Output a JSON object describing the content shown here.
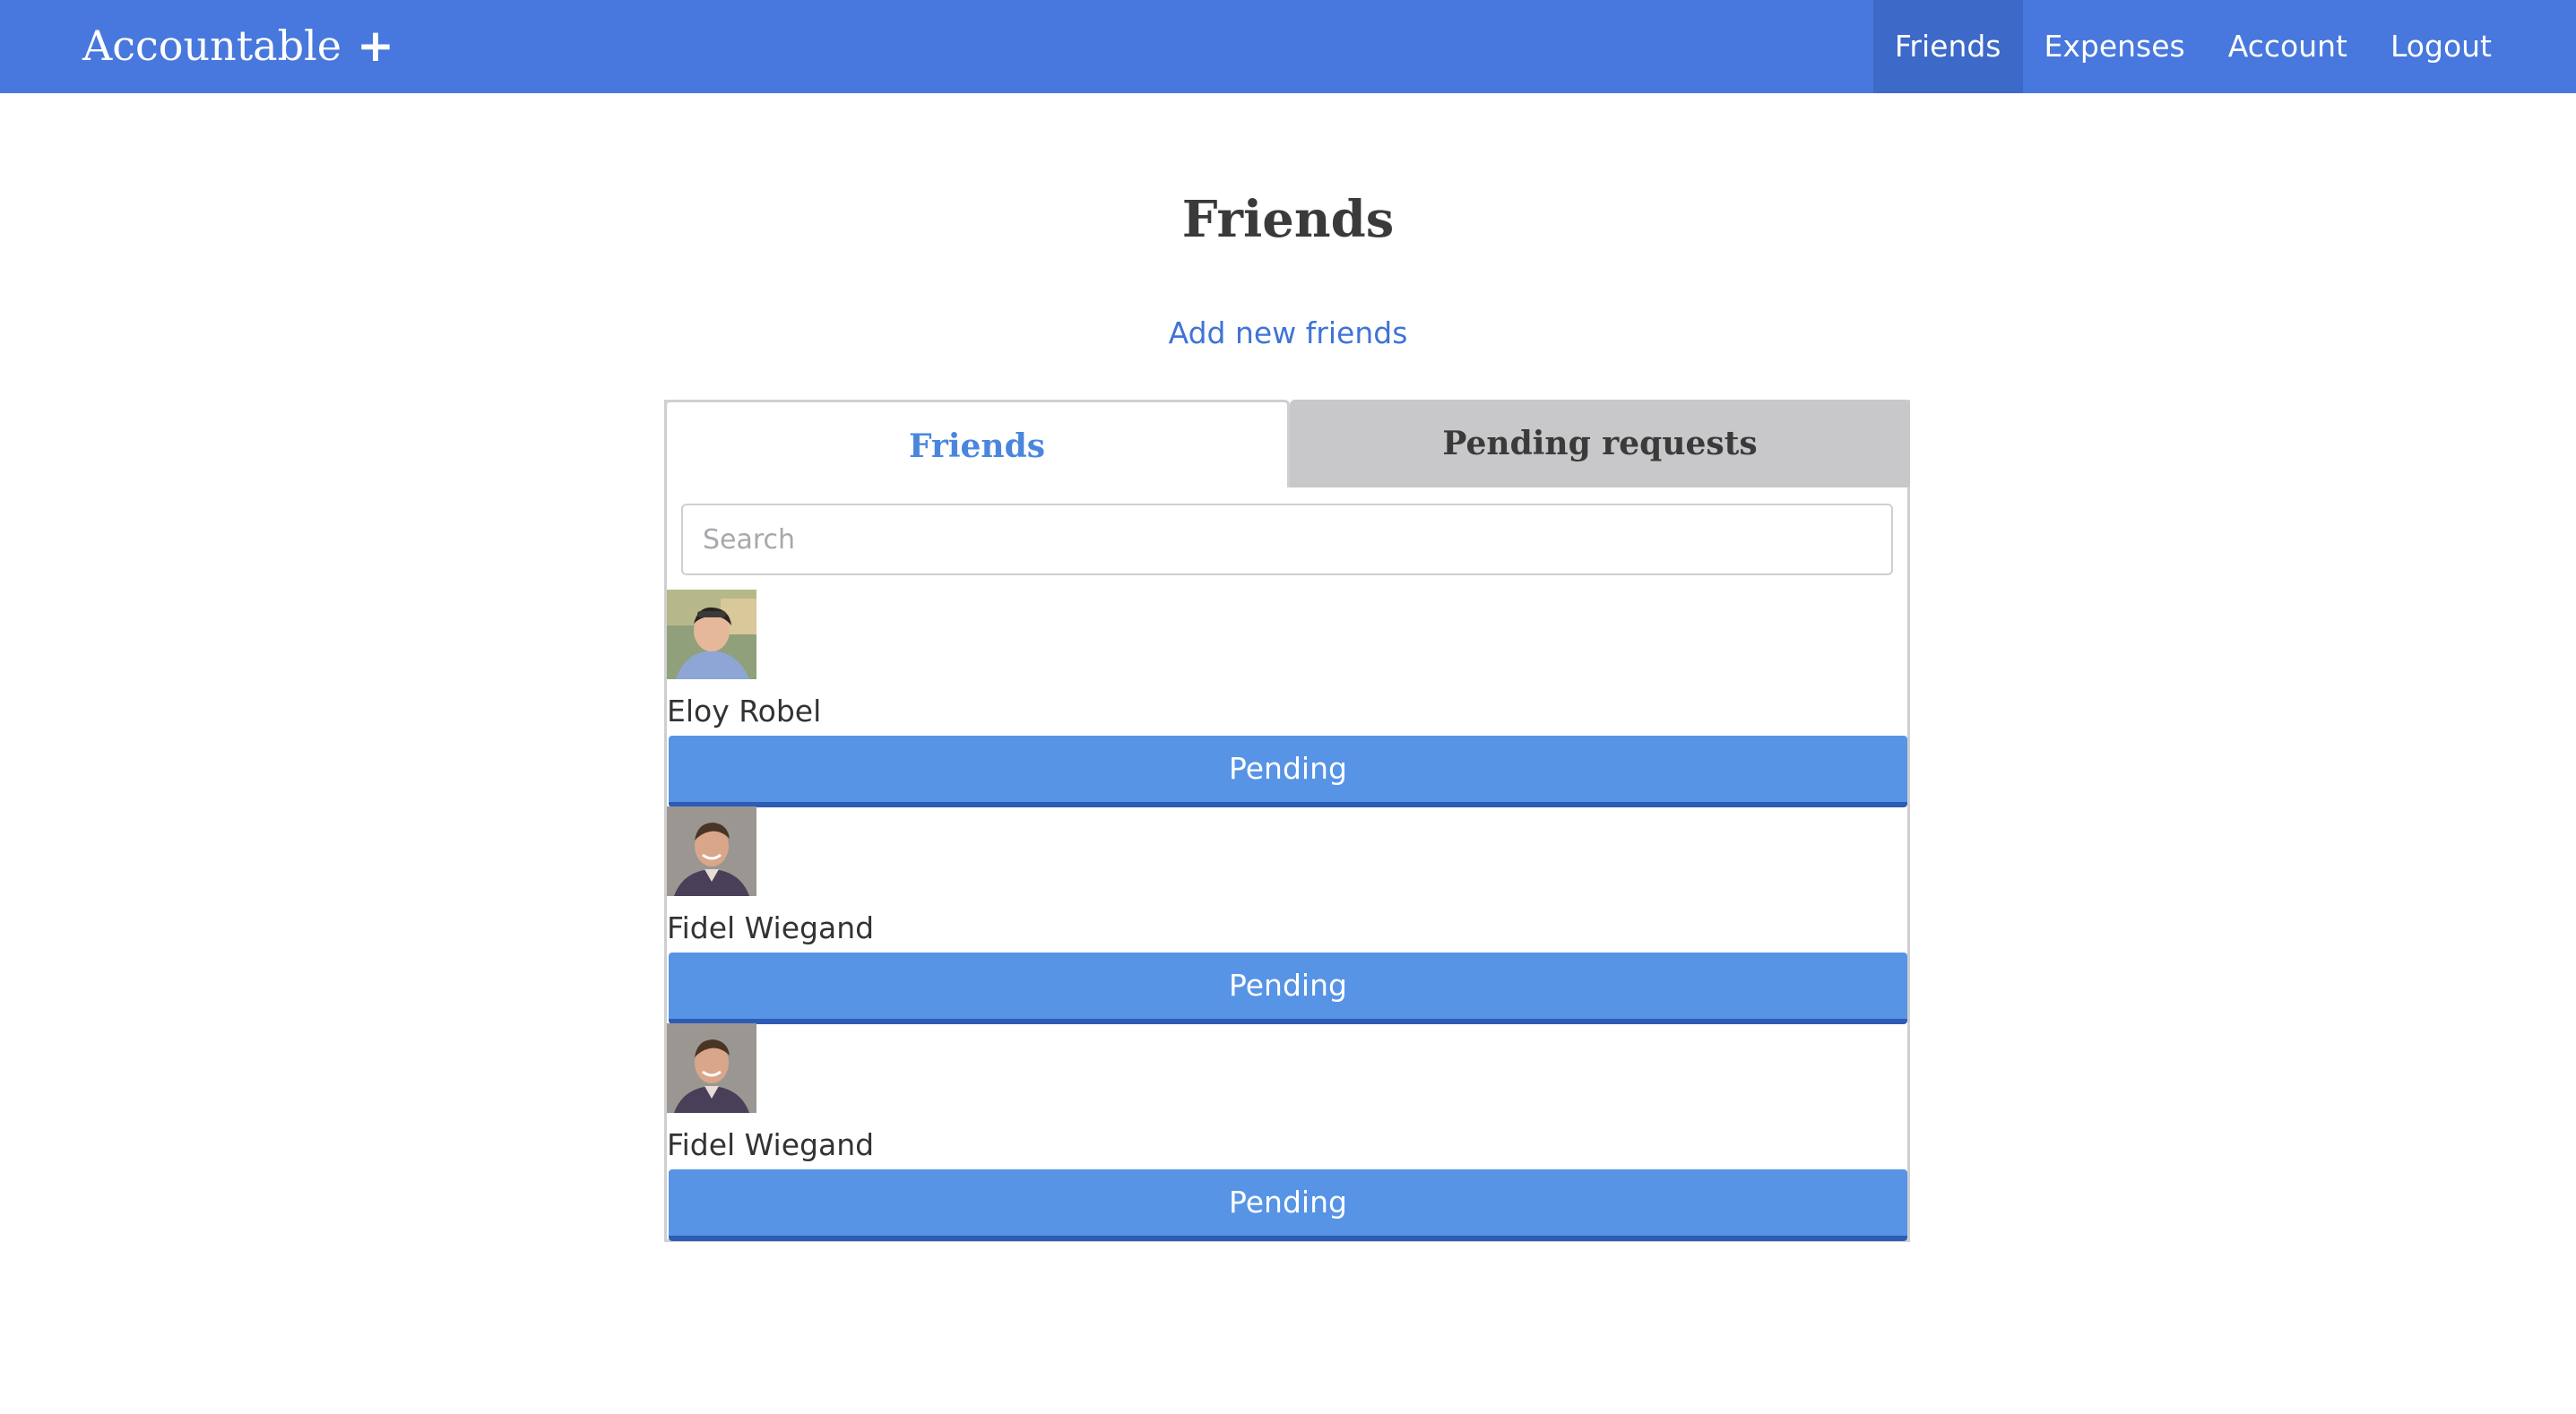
{
  "navbar": {
    "brand": "Accountable",
    "plus": "+",
    "links": [
      {
        "label": "Friends",
        "active": true
      },
      {
        "label": "Expenses",
        "active": false
      },
      {
        "label": "Account",
        "active": false
      },
      {
        "label": "Logout",
        "active": false
      }
    ]
  },
  "main": {
    "title": "Friends",
    "add_link": "Add new friends",
    "tabs": [
      {
        "label": "Friends",
        "active": true
      },
      {
        "label": "Pending requests",
        "active": false
      }
    ],
    "search": {
      "placeholder": "Search",
      "value": ""
    },
    "friends": [
      {
        "name": "Eloy Robel",
        "button": "Pending",
        "avatar": "photo-man-outdoors"
      },
      {
        "name": "Fidel Wiegand",
        "button": "Pending",
        "avatar": "photo-man-smiling"
      },
      {
        "name": "Fidel Wiegand",
        "button": "Pending",
        "avatar": "photo-man-smiling"
      }
    ]
  },
  "colors": {
    "navbar": "#4878dd",
    "nav_active": "#3d69c8",
    "link": "#3f74d6",
    "active_tab_text": "#4a86de",
    "inactive_tab_bg": "#c8c7c9",
    "button": "#5794e6",
    "button_border": "#2e5bb4"
  }
}
